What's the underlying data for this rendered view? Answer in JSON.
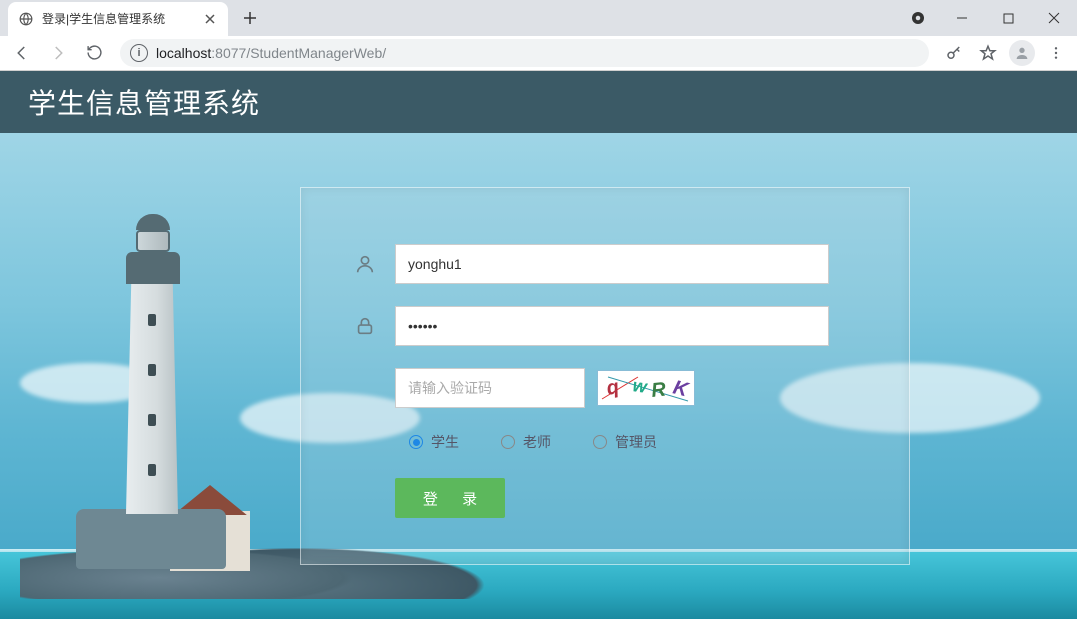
{
  "browser": {
    "tab_title": "登录|学生信息管理系统",
    "url_host": "localhost",
    "url_port": ":8077",
    "url_path": "/StudentManagerWeb/"
  },
  "header": {
    "title": "学生信息管理系统"
  },
  "login": {
    "username_value": "yonghu1",
    "password_value": "••••••",
    "captcha_placeholder": "请输入验证码",
    "roles": {
      "student": "学生",
      "teacher": "老师",
      "admin": "管理员"
    },
    "selected_role": "student",
    "submit_label": "登 录"
  }
}
